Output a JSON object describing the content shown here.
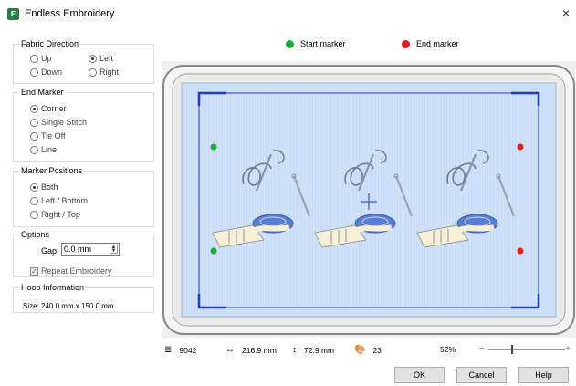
{
  "window": {
    "title": "Endless Embroidery",
    "close_glyph": "×"
  },
  "fabric_direction": {
    "label": "Fabric Direction",
    "options": [
      {
        "label": "Up",
        "selected": false
      },
      {
        "label": "Left",
        "selected": true
      },
      {
        "label": "Down",
        "selected": false
      },
      {
        "label": "Right",
        "selected": false
      }
    ]
  },
  "end_marker": {
    "label": "End Marker",
    "options": [
      {
        "label": "Corner",
        "selected": true
      },
      {
        "label": "Single Stitch",
        "selected": false
      },
      {
        "label": "Tie Off",
        "selected": false
      },
      {
        "label": "Line",
        "selected": false
      }
    ]
  },
  "marker_positions": {
    "label": "Marker Positions",
    "options": [
      {
        "label": "Both",
        "selected": true
      },
      {
        "label": "Left / Bottom",
        "selected": false
      },
      {
        "label": "Right / Top",
        "selected": false
      }
    ]
  },
  "options_group": {
    "label": "Options",
    "gap_label": "Gap:",
    "gap_value": "0.0 mm",
    "repeat_label": "Repeat Embroidery",
    "repeat_checked": true
  },
  "hoop_info": {
    "label": "Hoop Information",
    "size": "Size:   240.0 mm x 150.0 mm"
  },
  "legend": {
    "start": {
      "label": "Start marker",
      "color": "#1ea83c"
    },
    "end": {
      "label": "End marker",
      "color": "#e02020"
    }
  },
  "status": {
    "stitches": "9042",
    "width": "216.9 mm",
    "height": "72.9 mm",
    "colors": "23",
    "zoom": "52%",
    "zoom_minus": "−",
    "zoom_plus": "+",
    "zoom_fraction": 0.3
  },
  "buttons": {
    "ok": "OK",
    "cancel": "Cancel",
    "help": "Help"
  },
  "colors": {
    "hoop_blue": "#c9dcf3",
    "frame_blue": "#1f3cc8",
    "accent": "#2d7f3f"
  }
}
